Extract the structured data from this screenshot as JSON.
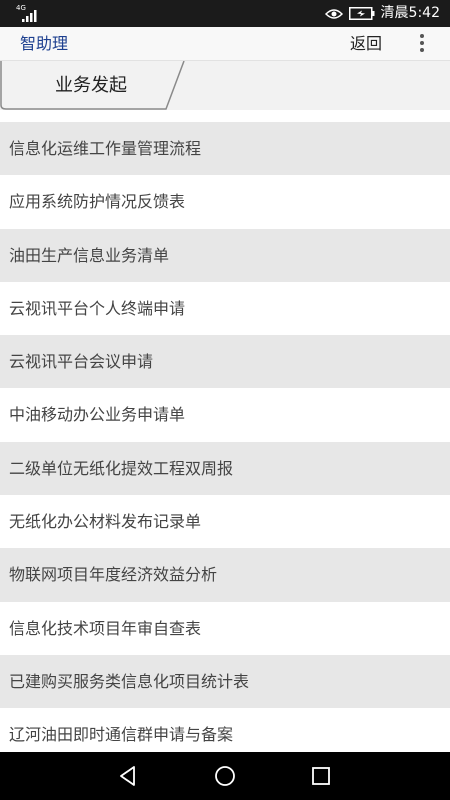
{
  "status_bar": {
    "network": "4G",
    "carrier": "清晨",
    "time": "5:42",
    "icons": [
      "signal-icon",
      "eye-icon",
      "battery-icon"
    ]
  },
  "header": {
    "title": "智助理",
    "back_label": "返回",
    "more_icon": "more-vertical-icon"
  },
  "tab": {
    "label": "业务发起"
  },
  "list": {
    "items": [
      "信息化运维工作量管理流程",
      "应用系统防护情况反馈表",
      "油田生产信息业务清单",
      "云视讯平台个人终端申请",
      "云视讯平台会议申请",
      "中油移动办公业务申请单",
      "二级单位无纸化提效工程双周报",
      "无纸化办公材料发布记录单",
      "物联网项目年度经济效益分析",
      "信息化技术项目年审自查表",
      "已建购买服务类信息化项目统计表",
      "辽河油田即时通信群申请与备案"
    ]
  },
  "nav_bar": {
    "icons": [
      "back-triangle-icon",
      "home-circle-icon",
      "recents-square-icon"
    ]
  },
  "colors": {
    "title": "#1d3f8f",
    "row_alt": "#e7e7e7",
    "status_bar": "#1b1b1b",
    "nav_bar": "#000000"
  }
}
